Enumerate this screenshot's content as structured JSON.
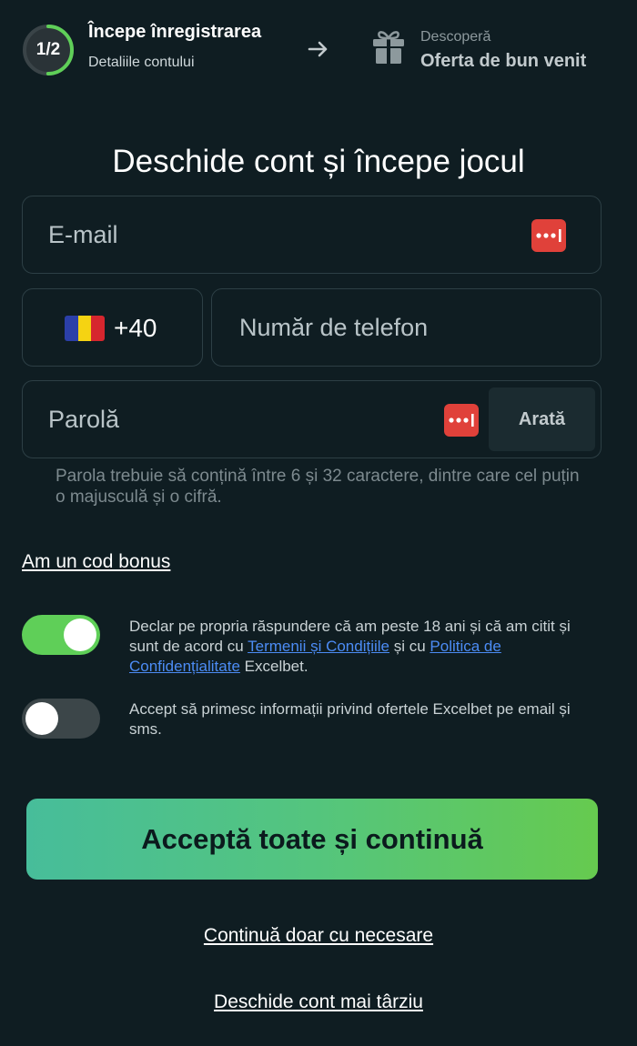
{
  "header": {
    "progress_label": "1/2",
    "progress_fraction": 0.5,
    "step1_title": "Începe înregistrarea",
    "step1_subtitle": "Detaliile contului",
    "step2_label": "Descoperă",
    "step2_title": "Oferta de bun venit"
  },
  "title": "Deschide cont și începe jocul",
  "form": {
    "email_placeholder": "E-mail",
    "dial_code": "+40",
    "phone_placeholder": "Număr de telefon",
    "password_placeholder": "Parolă",
    "show_password_label": "Arată",
    "password_hint": "Parola trebuie să conțină între 6 și 32 caractere, dintre care cel puțin o majusculă și o cifră."
  },
  "bonus_link": "Am un cod bonus",
  "consents": {
    "terms": {
      "enabled": true,
      "text_before": "Declar pe propria răspundere că am peste 18 ani și că am citit și sunt de acord cu ",
      "terms_link": "Termenii și Condițiile",
      "text_middle": " și cu ",
      "privacy_link": "Politica de Confidențialitate",
      "text_after": " Excelbet."
    },
    "offers": {
      "enabled": false,
      "text": "Accept să primesc informații privind ofertele Excelbet pe email și sms."
    }
  },
  "buttons": {
    "accept_all": "Acceptă toate și continuă",
    "necessary_only": "Continuă doar cu necesare",
    "later": "Deschide cont mai târziu"
  },
  "colors": {
    "background": "#0f1d22",
    "accent_green": "#5fcf58",
    "link_blue": "#4c8cf5",
    "password_manager_red": "#e0413a"
  },
  "icons": {
    "arrow": "arrow-right-icon",
    "gift": "gift-icon",
    "flag": "romania-flag-icon",
    "password_manager": "password-manager-icon"
  }
}
